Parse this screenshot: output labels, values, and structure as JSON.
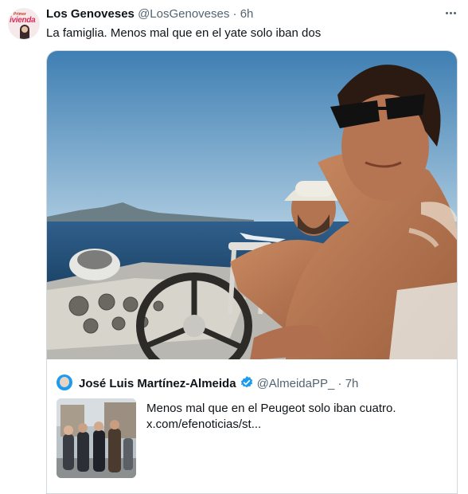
{
  "tweet": {
    "avatar_text_top": "Primer",
    "avatar_text_main": "ivienda",
    "author_name": "Los Genoveses",
    "author_handle": "@LosGenoveses",
    "separator": "·",
    "time": "6h",
    "text": "La famiglia. Menos mal que en el yate solo iban dos"
  },
  "quoted_tweet": {
    "author_name": "José Luis Martínez-Almeida",
    "author_handle": "@AlmeidaPP_",
    "separator": "·",
    "time": "7h",
    "text_line1": "Menos mal que en el Peugeot solo iban cuatro.",
    "text_line2": "x.com/efenoticias/st..."
  },
  "colors": {
    "text_primary": "#0f1419",
    "text_secondary": "#536471",
    "verified": "#1d9bf0",
    "border": "#cfd9de"
  }
}
